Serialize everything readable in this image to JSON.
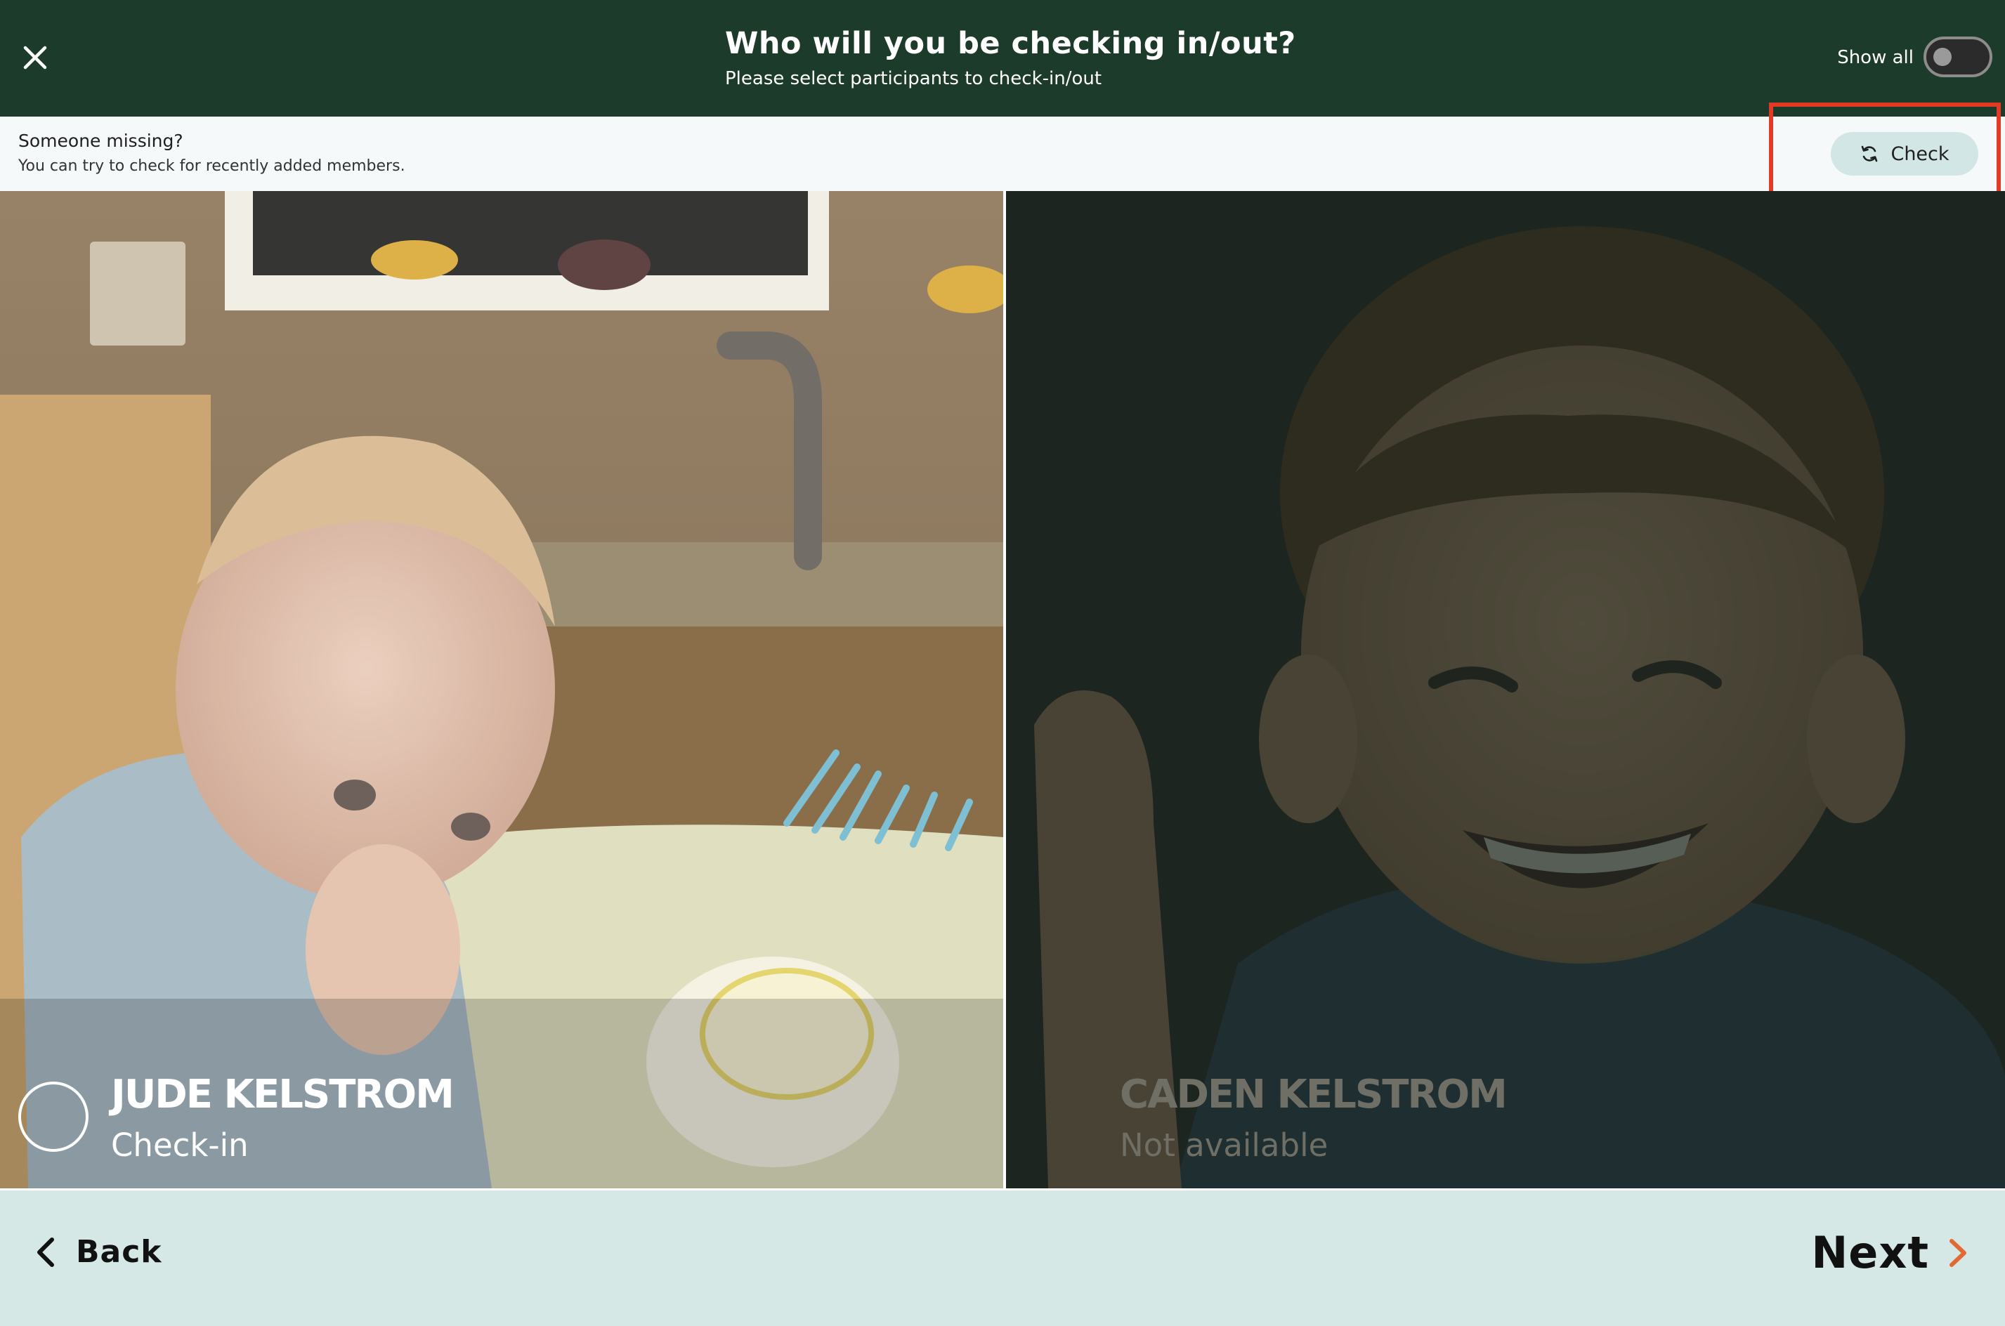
{
  "header": {
    "title": "Who will you be checking in/out?",
    "subtitle": "Please select participants to check-in/out",
    "show_all_label": "Show all",
    "show_all_on": false,
    "close_icon": "close-icon"
  },
  "info": {
    "title": "Someone missing?",
    "subtitle": "You can try to check for recently added members.",
    "check_label": "Check",
    "check_icon": "refresh-icon"
  },
  "participants": [
    {
      "name": "JUDE KELSTROM",
      "status": "Check-in",
      "available": true,
      "selected": false
    },
    {
      "name": "CADEN KELSTROM",
      "status": "Not available",
      "available": false
    }
  ],
  "footer": {
    "back_label": "Back",
    "next_label": "Next"
  },
  "colors": {
    "header_bg": "#1c3b2a",
    "footer_bg": "#d5e8e6",
    "check_button_bg": "#d2e6e5",
    "highlight": "#e13b26",
    "next_chevron": "#e06a32"
  }
}
